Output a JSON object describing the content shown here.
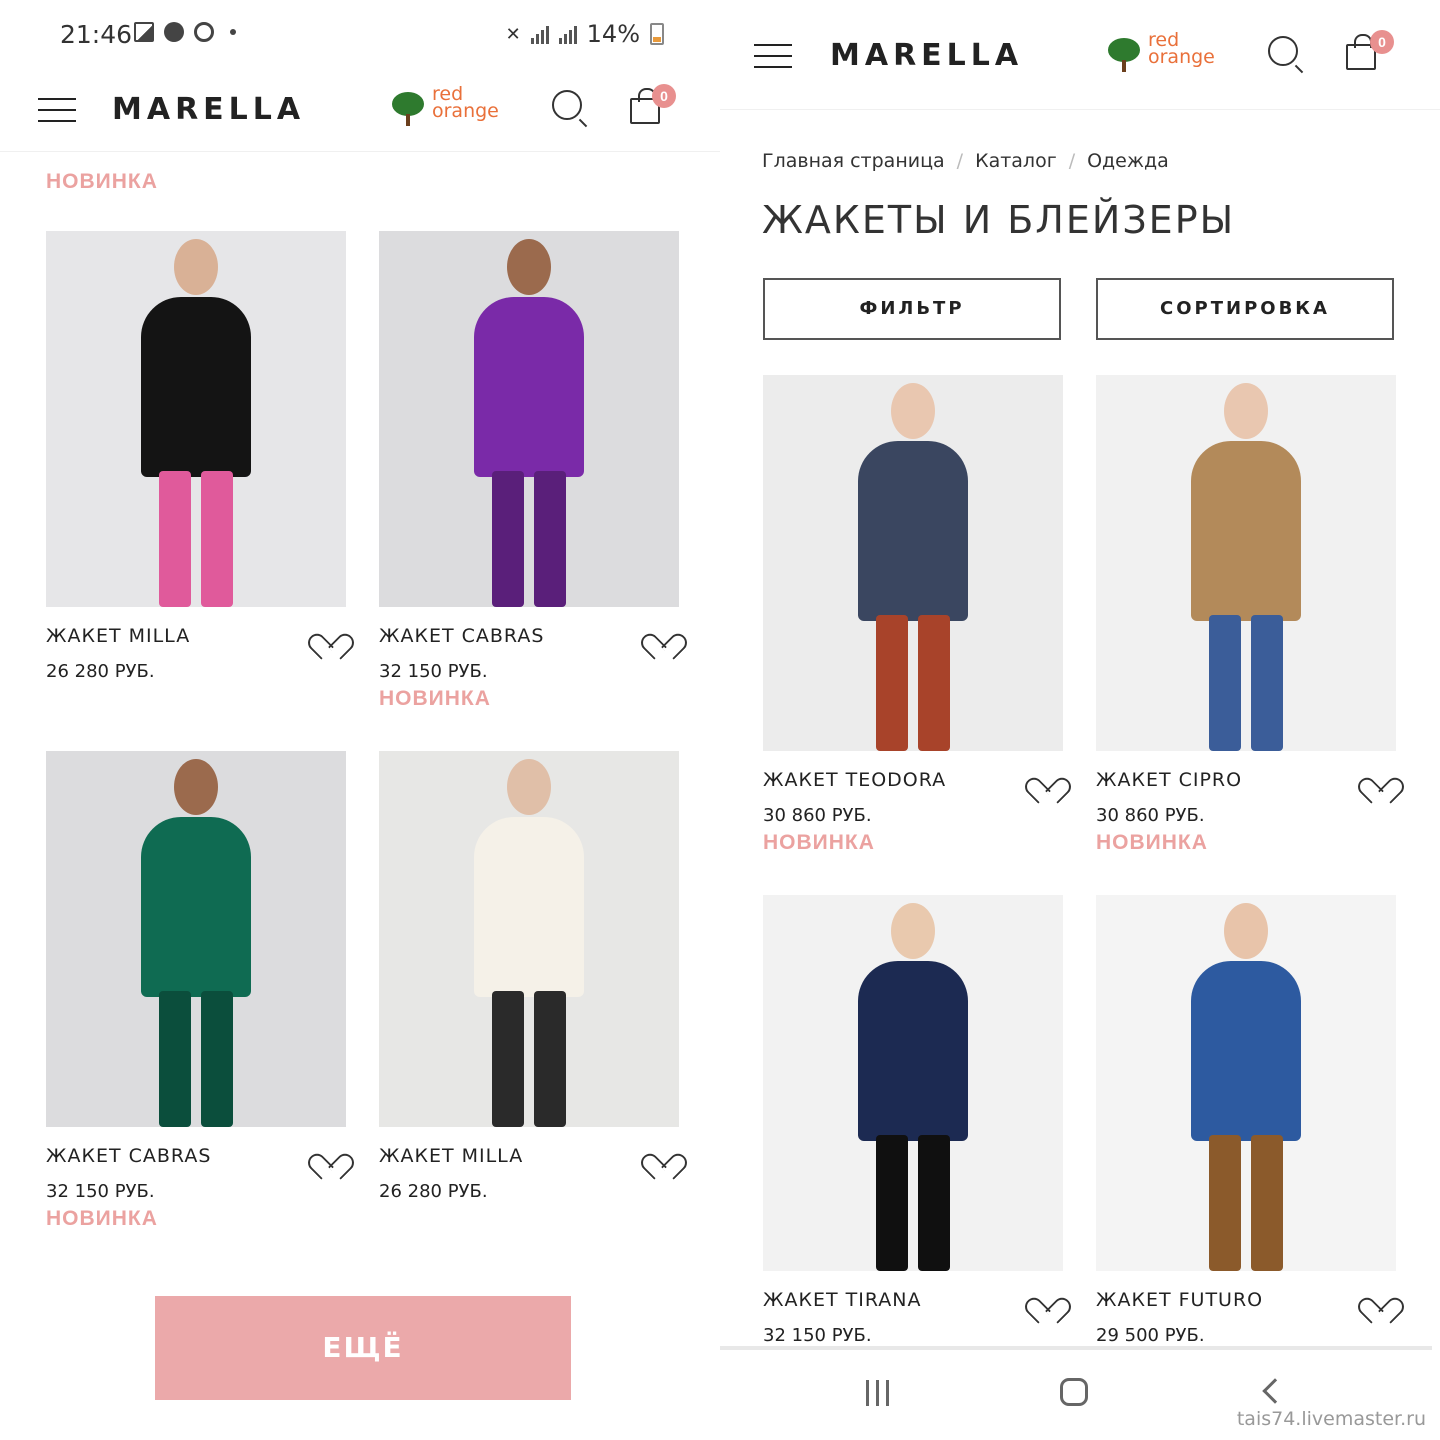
{
  "status_bar": {
    "time": "21:46",
    "battery": "14%"
  },
  "brand": {
    "logo": "MARELLA",
    "partner_logo": "red orange",
    "cart_count": "0"
  },
  "left": {
    "top_badge": "НОВИНКА",
    "products": [
      {
        "name": "ЖАКЕТ MILLA",
        "price": "26 280 РУБ.",
        "badge": "",
        "colors": {
          "bg": "#e6e6e8",
          "suit": "#141414",
          "skin": "#d9b196",
          "accent": "#e05a9b"
        }
      },
      {
        "name": "ЖАКЕТ CABRAS",
        "price": "32 150 РУБ.",
        "badge": "НОВИНКА",
        "colors": {
          "bg": "#dcdcde",
          "suit": "#7a2aa8",
          "skin": "#9b6a4d",
          "accent": "#5a1f7a"
        }
      },
      {
        "name": "ЖАКЕТ CABRAS",
        "price": "32 150 РУБ.",
        "badge": "НОВИНКА",
        "colors": {
          "bg": "#dcdcde",
          "suit": "#0f6b52",
          "skin": "#9b6a4d",
          "accent": "#0b4e3c"
        }
      },
      {
        "name": "ЖАКЕТ MILLA",
        "price": "26 280 РУБ.",
        "badge": "",
        "colors": {
          "bg": "#e7e7e5",
          "suit": "#f5f1e8",
          "skin": "#e0bfa8",
          "accent": "#2a2a2a"
        }
      }
    ],
    "more_button": "ЕЩЁ"
  },
  "right": {
    "breadcrumb": [
      "Главная страница",
      "Каталог",
      "Одежда"
    ],
    "page_title": "ЖАКЕТЫ И БЛЕЙЗЕРЫ",
    "filter_button": "ФИЛЬТР",
    "sort_button": "СОРТИРОВКА",
    "products": [
      {
        "name": "ЖАКЕТ TEODORA",
        "price": "30 860 РУБ.",
        "badge": "НОВИНКА",
        "colors": {
          "bg": "#ececec",
          "suit": "#3a4660",
          "skin": "#e9c7b0",
          "accent": "#a8432a"
        }
      },
      {
        "name": "ЖАКЕТ CIPRO",
        "price": "30 860 РУБ.",
        "badge": "НОВИНКА",
        "colors": {
          "bg": "#f1f1f1",
          "suit": "#b38a5a",
          "skin": "#e9c7b0",
          "accent": "#3b5d99"
        }
      },
      {
        "name": "ЖАКЕТ TIRANA",
        "price": "32 150 РУБ.",
        "badge": "",
        "colors": {
          "bg": "#f2f2f2",
          "suit": "#1c2a52",
          "skin": "#e9c9ae",
          "accent": "#101010"
        }
      },
      {
        "name": "ЖАКЕТ FUTURO",
        "price": "29 500 РУБ.",
        "badge": "",
        "colors": {
          "bg": "#f4f4f4",
          "suit": "#2d5aa0",
          "skin": "#e8c4aa",
          "accent": "#8b5a2b"
        }
      }
    ]
  },
  "watermark": "tais74.livemaster.ru"
}
